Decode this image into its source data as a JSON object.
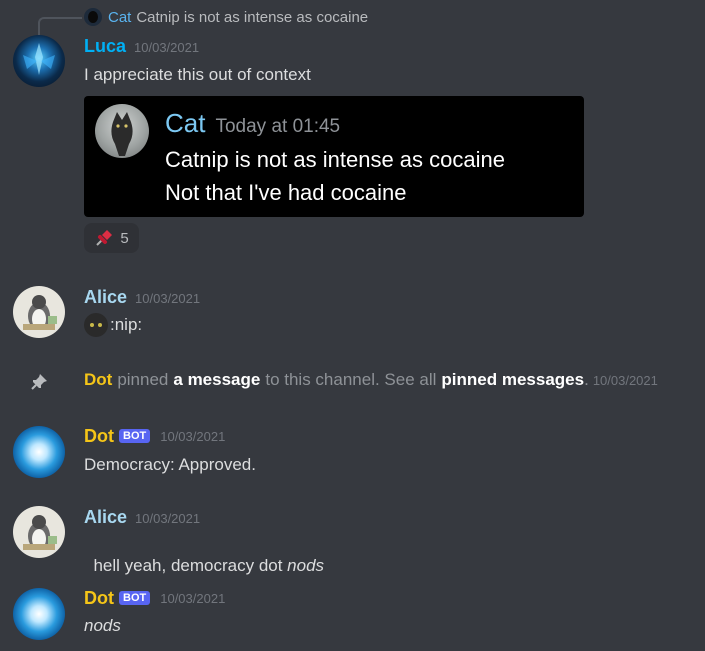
{
  "reply": {
    "author": "Cat",
    "text": "Catnip is not as intense as cocaine",
    "author_color": "#5ab4f0"
  },
  "messages": [
    {
      "author": "Luca",
      "author_color": "#00b0f4",
      "timestamp": "10/03/2021",
      "text": "I appreciate this out of context",
      "embed": {
        "author": "Cat",
        "timestamp": "Today at 01:45",
        "line1": "Catnip is not as intense as cocaine",
        "line2": "Not that I've had cocaine"
      },
      "reaction": {
        "emoji": "pushpin",
        "count": "5"
      }
    },
    {
      "author": "Alice",
      "author_color": "#a8d8f0",
      "timestamp": "10/03/2021",
      "text": ":nip:"
    },
    {
      "system": true,
      "actor": "Dot",
      "t1": "pinned",
      "link1": "a message",
      "t2": "to this channel. See all",
      "link2": "pinned messages",
      "t3": ".",
      "timestamp": "10/03/2021"
    },
    {
      "author": "Dot",
      "author_color": "#f5c518",
      "bot_tag": "BOT",
      "timestamp": "10/03/2021",
      "text": "Democracy: Approved."
    },
    {
      "author": "Alice",
      "author_color": "#a8d8f0",
      "timestamp": "10/03/2021",
      "text": "hell yeah, democracy dot ",
      "text_italic": "nods"
    },
    {
      "author": "Dot",
      "author_color": "#f5c518",
      "bot_tag": "BOT",
      "timestamp": "10/03/2021",
      "text_italic": "nods"
    }
  ]
}
